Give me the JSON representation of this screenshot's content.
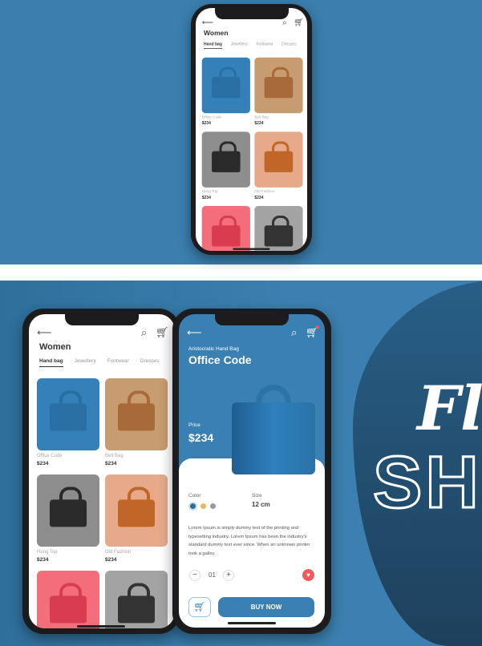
{
  "brand": {
    "line1": "Fl",
    "line2": "SH"
  },
  "list": {
    "title": "Women",
    "tabs": [
      "Hand bag",
      "Jewellery",
      "Footwear",
      "Dresses"
    ],
    "active_tab": "Hand bag",
    "products": [
      {
        "name": "Office Code",
        "price": "$234",
        "bg": "#3480b8",
        "bag": "#2a6fa3"
      },
      {
        "name": "Belt Bag",
        "price": "$234",
        "bg": "#c79c70",
        "bag": "#a86a38"
      },
      {
        "name": "Hang Top",
        "price": "$234",
        "bg": "#8e8d8d",
        "bag": "#2a2a2a"
      },
      {
        "name": "Old Fashion",
        "price": "$234",
        "bg": "#e6aa8a",
        "bag": "#c06628"
      },
      {
        "name": "",
        "price": "",
        "bg": "#f46d7b",
        "bag": "#d83c4f"
      },
      {
        "name": "",
        "price": "",
        "bg": "#a3a3a3",
        "bag": "#333333"
      }
    ]
  },
  "detail": {
    "subtitle": "Aristocratic Hand Bag",
    "title": "Office Code",
    "price_label": "Price",
    "price": "$234",
    "color_label": "Color",
    "colors": [
      "#2f6c9e",
      "#f2b35a",
      "#9a9a9a"
    ],
    "size_label": "Size",
    "size": "12 cm",
    "description": "Lorem Ipsum is simply dummy text of the printing and typesetting industry. Lorem Ipsum has been the industry's standard dummy text ever since. When an unknown printer took a galley.",
    "quantity": "01",
    "buy_label": "BUY NOW"
  }
}
